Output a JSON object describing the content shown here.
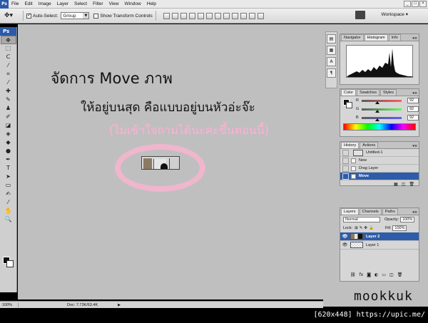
{
  "menubar": {
    "logo": "Ps",
    "items": [
      "File",
      "Edit",
      "Image",
      "Layer",
      "Select",
      "Filter",
      "View",
      "Window",
      "Help"
    ],
    "win_min": "_",
    "win_max": "□",
    "win_close": "×"
  },
  "options": {
    "auto_select_label": "Auto-Select:",
    "auto_select_value": "Group",
    "show_transform_label": "Show Transform Controls",
    "workspace_label": "Workspace ▾"
  },
  "toolbox": {
    "ps": "Ps"
  },
  "canvas": {
    "title": "จัดการ Move ภาพ",
    "line2": "ให้อยู่บนสุด คือแบบอยู่บนหัวอ่ะจ๊ะ",
    "line3": "(ไม่เข้าใจถามได้นะคะขึ้นตอนนี้)"
  },
  "status": {
    "zoom": "100%",
    "doc": "Doc: 7.73K/63.4K",
    "arrow": "▶"
  },
  "navigator_panel": {
    "tabs": [
      "Navigator",
      "Histogram",
      "Info"
    ],
    "active": "Histogram"
  },
  "color_panel": {
    "tabs": [
      "Color",
      "Swatches",
      "Styles"
    ],
    "channels": [
      {
        "label": "R",
        "value": "92"
      },
      {
        "label": "G",
        "value": "92"
      },
      {
        "label": "B",
        "value": "92"
      }
    ]
  },
  "history_panel": {
    "tabs": [
      "History",
      "Actions"
    ],
    "snapshot": "Untitled-1",
    "states": [
      "New",
      "Drag Layer",
      "Move"
    ],
    "selected": "Move"
  },
  "layers_panel": {
    "tabs": [
      "Layers",
      "Channels",
      "Paths"
    ],
    "blend_mode": "Normal",
    "opacity_label": "Opacity:",
    "opacity_value": "100%",
    "lock_label": "Lock:",
    "fill_label": "Fill:",
    "fill_value": "100%",
    "layers": [
      {
        "name": "Layer 2",
        "selected": true
      },
      {
        "name": "Layer 1",
        "selected": false
      }
    ]
  },
  "watermark": "mookkuk",
  "credit": "[620x448] https://upic.me/"
}
